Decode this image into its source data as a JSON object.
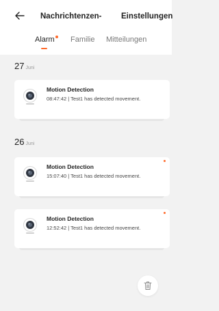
{
  "header": {
    "back_icon": "arrow-left-icon",
    "title": "Nachrichtenzen-",
    "settings": "Einstellungen"
  },
  "tabs": [
    {
      "label": "Alarm",
      "active": true,
      "has_dot": true
    },
    {
      "label": "Familie",
      "active": false
    },
    {
      "label": "Mitteilungen",
      "active": false
    }
  ],
  "groups": [
    {
      "day": "27",
      "month": "Juni",
      "items": [
        {
          "title": "Motion Detection",
          "description": "08:47:42 | Test1 has detected movement.",
          "unread": false,
          "icon": "camera-icon"
        }
      ]
    },
    {
      "day": "26",
      "month": "Juni",
      "items": [
        {
          "title": "Motion Detection",
          "description": "15:07:40 | Test1 has detected movement.",
          "unread": true,
          "icon": "camera-icon"
        },
        {
          "title": "Motion Detection",
          "description": "12:52:42 | Test1 has detected movement.",
          "unread": true,
          "icon": "camera-icon"
        }
      ]
    }
  ],
  "delete_button": {
    "icon": "trash-icon"
  },
  "colors": {
    "accent": "#ff6a2a",
    "background": "#f2f2f2",
    "card": "#ffffff"
  }
}
